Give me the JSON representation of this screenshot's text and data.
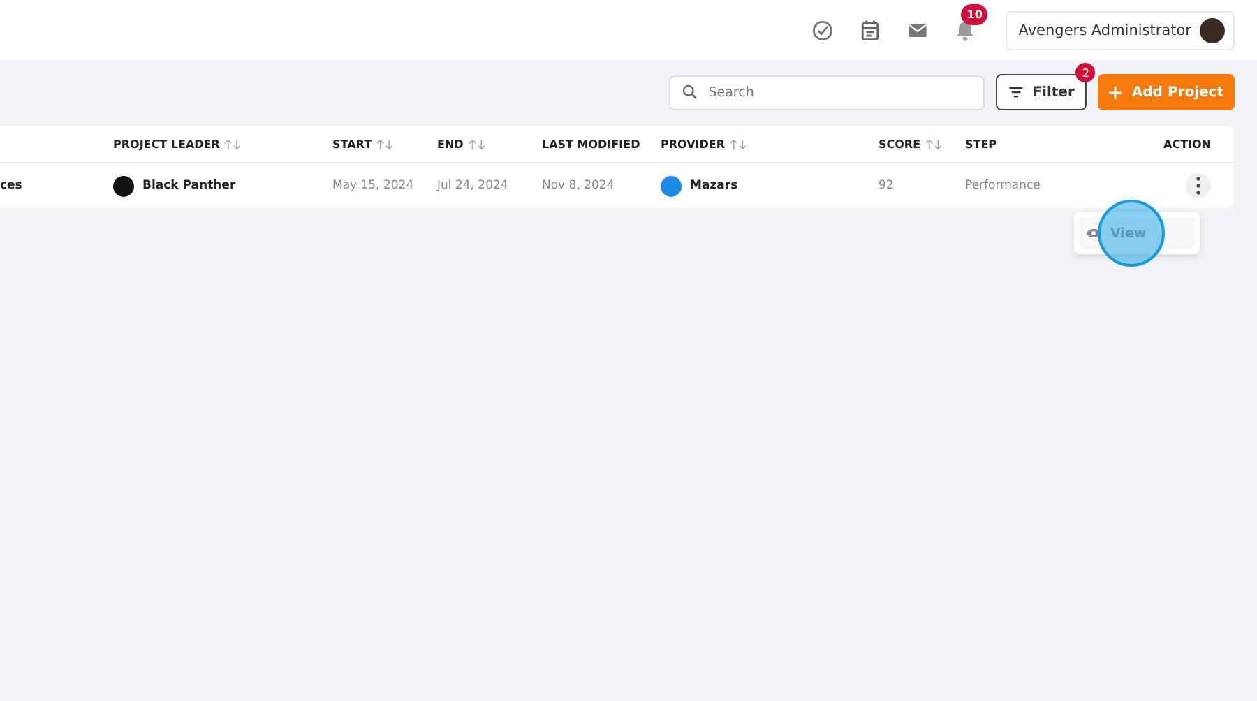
{
  "header": {
    "notification_count": "10",
    "user_name": "Avengers Administrator"
  },
  "toolbar": {
    "search": {
      "placeholder": "Search"
    },
    "filter": {
      "label": "Filter",
      "badge": "2"
    },
    "add_button": {
      "label": "Add Project"
    }
  },
  "table": {
    "columns": [
      {
        "label": "PROJECT LEADER",
        "sortable": true
      },
      {
        "label": "START",
        "sortable": true
      },
      {
        "label": "END",
        "sortable": true
      },
      {
        "label": "LAST MODIFIED"
      },
      {
        "label": "PROVIDER",
        "sortable": true
      },
      {
        "label": "SCORE",
        "sortable": true
      },
      {
        "label": "STEP"
      },
      {
        "label": "ACTION"
      }
    ],
    "rows": [
      {
        "column_1": "ces",
        "leader": "Black Panther",
        "start": "May 15, 2024",
        "end": "Jul 24, 2024",
        "last_modified": "Nov 8, 2024",
        "provider": "Mazars",
        "score": "92",
        "step": "Performance"
      }
    ]
  },
  "action_menu": {
    "items": [
      {
        "label": "View"
      }
    ]
  }
}
